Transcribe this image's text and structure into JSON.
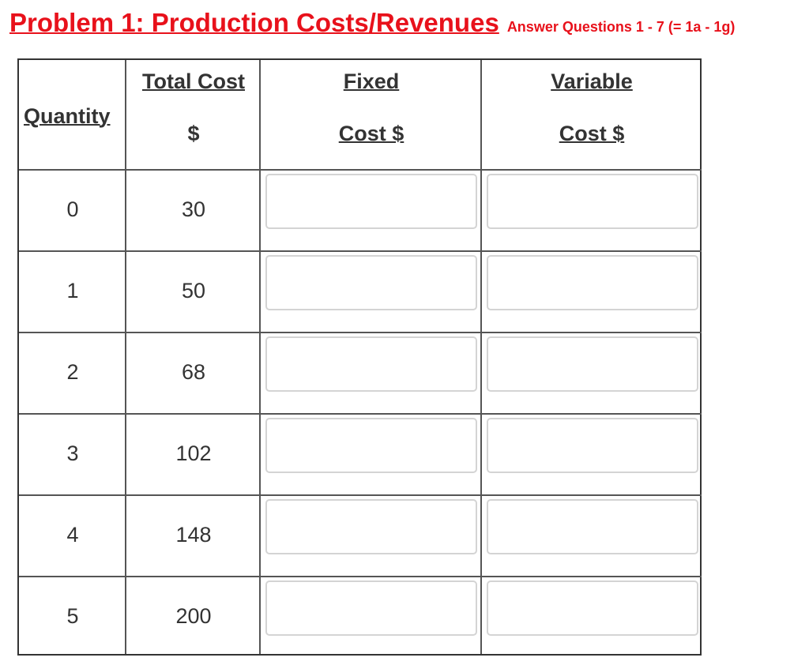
{
  "title": {
    "main": "Problem 1:  Production Costs/Revenues",
    "sub": "Answer Questions 1 - 7 (= 1a - 1g)"
  },
  "table": {
    "headers": {
      "quantity": "Quantity",
      "total_cost_line1": "Total Cost ",
      "total_cost_line2": "$",
      "fixed_line1": "Fixed",
      "fixed_line2": "Cost $",
      "variable_line1": "Variable",
      "variable_line2": "Cost $"
    },
    "rows": [
      {
        "quantity": "0",
        "total_cost": "30",
        "fixed_cost": "",
        "variable_cost": ""
      },
      {
        "quantity": "1",
        "total_cost": "50",
        "fixed_cost": "",
        "variable_cost": ""
      },
      {
        "quantity": "2",
        "total_cost": "68",
        "fixed_cost": "",
        "variable_cost": ""
      },
      {
        "quantity": "3",
        "total_cost": "102",
        "fixed_cost": "",
        "variable_cost": ""
      },
      {
        "quantity": "4",
        "total_cost": "148",
        "fixed_cost": "",
        "variable_cost": ""
      },
      {
        "quantity": "5",
        "total_cost": "200",
        "fixed_cost": "",
        "variable_cost": ""
      }
    ]
  }
}
